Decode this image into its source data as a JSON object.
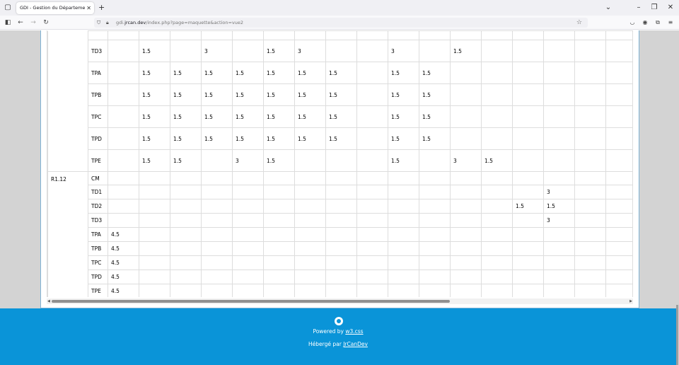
{
  "browser": {
    "tab_title": "GDI - Gestion du Département Info",
    "tab_close": "✕",
    "new_tab": "+",
    "url_prefix": "gdi.",
    "url_host": "jrcan.dev",
    "url_path": "/index.php?page=maquette&action=vue2"
  },
  "table": {
    "rows": [
      {
        "module": "",
        "group": "",
        "cells": [
          "",
          "",
          "",
          "",
          "",
          "",
          "",
          "",
          "",
          "",
          "",
          "",
          "",
          "",
          "",
          "",
          ""
        ]
      },
      {
        "module": "",
        "group": "TD3",
        "cells": [
          "",
          "1.5",
          "",
          "3",
          "",
          "1.5",
          "3",
          "",
          "",
          "3",
          "",
          "1.5",
          "",
          "",
          "",
          "",
          ""
        ]
      },
      {
        "module": "",
        "group": "TPA",
        "cells": [
          "",
          "1.5",
          "1.5",
          "1.5",
          "1.5",
          "1.5",
          "1.5",
          "1.5",
          "",
          "1.5",
          "1.5",
          "",
          "",
          "",
          "",
          "",
          ""
        ]
      },
      {
        "module": "",
        "group": "TPB",
        "cells": [
          "",
          "1.5",
          "1.5",
          "1.5",
          "1.5",
          "1.5",
          "1.5",
          "1.5",
          "",
          "1.5",
          "1.5",
          "",
          "",
          "",
          "",
          "",
          ""
        ]
      },
      {
        "module": "",
        "group": "TPC",
        "cells": [
          "",
          "1.5",
          "1.5",
          "1.5",
          "1.5",
          "1.5",
          "1.5",
          "1.5",
          "",
          "1.5",
          "1.5",
          "",
          "",
          "",
          "",
          "",
          ""
        ]
      },
      {
        "module": "",
        "group": "TPD",
        "cells": [
          "",
          "1.5",
          "1.5",
          "1.5",
          "1.5",
          "1.5",
          "1.5",
          "1.5",
          "",
          "1.5",
          "1.5",
          "",
          "",
          "",
          "",
          "",
          ""
        ]
      },
      {
        "module": "",
        "group": "TPE",
        "cells": [
          "",
          "1.5",
          "1.5",
          "",
          "3",
          "1.5",
          "",
          "",
          "",
          "1.5",
          "",
          "3",
          "1.5",
          "",
          "",
          "",
          ""
        ]
      },
      {
        "module": "R1.12",
        "group": "CM",
        "cells": [
          "",
          "",
          "",
          "",
          "",
          "",
          "",
          "",
          "",
          "",
          "",
          "",
          "",
          "",
          "",
          "",
          ""
        ]
      },
      {
        "module": "",
        "group": "TD1",
        "cells": [
          "",
          "",
          "",
          "",
          "",
          "",
          "",
          "",
          "",
          "",
          "",
          "",
          "",
          "",
          "3",
          "",
          ""
        ]
      },
      {
        "module": "",
        "group": "TD2",
        "cells": [
          "",
          "",
          "",
          "",
          "",
          "",
          "",
          "",
          "",
          "",
          "",
          "",
          "",
          "1.5",
          "1.5",
          "",
          ""
        ]
      },
      {
        "module": "",
        "group": "TD3",
        "cells": [
          "",
          "",
          "",
          "",
          "",
          "",
          "",
          "",
          "",
          "",
          "",
          "",
          "",
          "",
          "3",
          "",
          ""
        ]
      },
      {
        "module": "",
        "group": "TPA",
        "cells": [
          "4.5",
          "",
          "",
          "",
          "",
          "",
          "",
          "",
          "",
          "",
          "",
          "",
          "",
          "",
          "",
          "",
          ""
        ]
      },
      {
        "module": "",
        "group": "TPB",
        "cells": [
          "4.5",
          "",
          "",
          "",
          "",
          "",
          "",
          "",
          "",
          "",
          "",
          "",
          "",
          "",
          "",
          "",
          ""
        ]
      },
      {
        "module": "",
        "group": "TPC",
        "cells": [
          "4.5",
          "",
          "",
          "",
          "",
          "",
          "",
          "",
          "",
          "",
          "",
          "",
          "",
          "",
          "",
          "",
          ""
        ]
      },
      {
        "module": "",
        "group": "TPD",
        "cells": [
          "4.5",
          "",
          "",
          "",
          "",
          "",
          "",
          "",
          "",
          "",
          "",
          "",
          "",
          "",
          "",
          "",
          ""
        ]
      },
      {
        "module": "",
        "group": "TPE",
        "cells": [
          "4.5",
          "",
          "",
          "",
          "",
          "",
          "",
          "",
          "",
          "",
          "",
          "",
          "",
          "",
          "",
          "",
          ""
        ]
      }
    ]
  },
  "footer": {
    "powered_prefix": "Powered by ",
    "powered_link": "w3.css",
    "hosted_prefix": "Hébergé par ",
    "hosted_link": "JrCanDev",
    "background": "#0a94d8"
  }
}
